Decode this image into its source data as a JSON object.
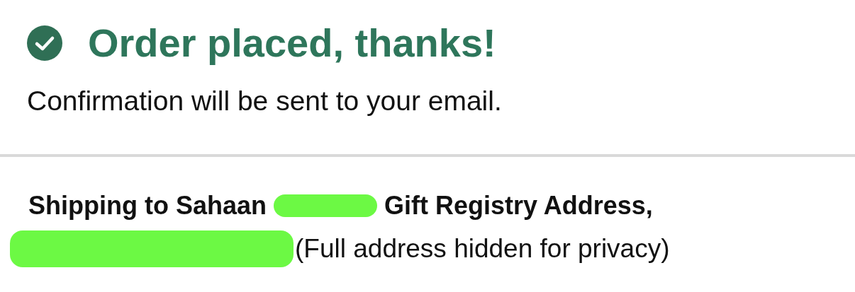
{
  "header": {
    "title": "Order placed, thanks!",
    "message": "Confirmation will be sent to your email."
  },
  "shipping": {
    "prefix": "Shipping to Sahaan",
    "suffix": "Gift Registry Address,",
    "note": "(Full address hidden for privacy)",
    "redacted": true
  }
}
